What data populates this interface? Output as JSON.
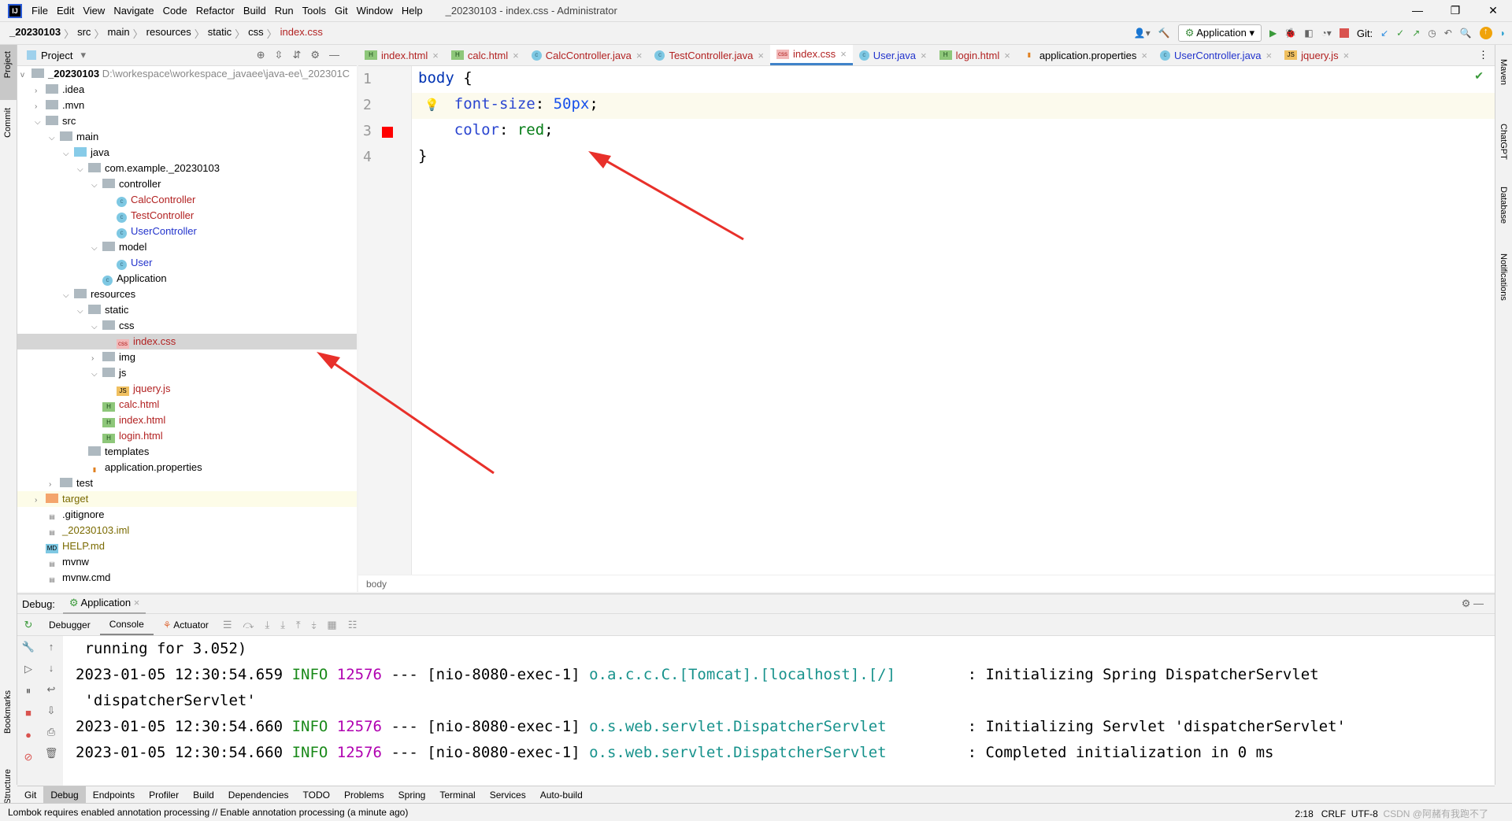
{
  "window": {
    "title": "_20230103 - index.css - Administrator",
    "logo": "IJ"
  },
  "menu": [
    "File",
    "Edit",
    "View",
    "Navigate",
    "Code",
    "Refactor",
    "Build",
    "Run",
    "Tools",
    "Git",
    "Window",
    "Help"
  ],
  "breadcrumb": [
    "_20230103",
    "src",
    "main",
    "resources",
    "static",
    "css",
    "index.css"
  ],
  "toolbar": {
    "run_config": "Application",
    "git_label": "Git:"
  },
  "project": {
    "header": "Project",
    "root_name": "_20230103",
    "root_path": "D:\\workespace\\workespace_javaee\\java-ee\\_202301C",
    "rows": [
      {
        "label": ".idea",
        "depth": 1,
        "chev": ">",
        "kind": "folder",
        "color": ""
      },
      {
        "label": ".mvn",
        "depth": 1,
        "chev": ">",
        "kind": "folder",
        "color": ""
      },
      {
        "label": "src",
        "depth": 1,
        "chev": "v",
        "kind": "folder",
        "color": ""
      },
      {
        "label": "main",
        "depth": 2,
        "chev": "v",
        "kind": "folder",
        "color": ""
      },
      {
        "label": "java",
        "depth": 3,
        "chev": "v",
        "kind": "jfolder",
        "color": ""
      },
      {
        "label": "com.example._20230103",
        "depth": 4,
        "chev": "v",
        "kind": "folder",
        "color": ""
      },
      {
        "label": "controller",
        "depth": 5,
        "chev": "v",
        "kind": "folder",
        "color": ""
      },
      {
        "label": "CalcController",
        "depth": 6,
        "chev": "",
        "kind": "class",
        "color": "red"
      },
      {
        "label": "TestController",
        "depth": 6,
        "chev": "",
        "kind": "class",
        "color": "red"
      },
      {
        "label": "UserController",
        "depth": 6,
        "chev": "",
        "kind": "class",
        "color": "blue"
      },
      {
        "label": "model",
        "depth": 5,
        "chev": "v",
        "kind": "folder",
        "color": ""
      },
      {
        "label": "User",
        "depth": 6,
        "chev": "",
        "kind": "class",
        "color": "blue"
      },
      {
        "label": "Application",
        "depth": 5,
        "chev": "",
        "kind": "app",
        "color": ""
      },
      {
        "label": "resources",
        "depth": 3,
        "chev": "v",
        "kind": "folder",
        "color": ""
      },
      {
        "label": "static",
        "depth": 4,
        "chev": "v",
        "kind": "folder",
        "color": ""
      },
      {
        "label": "css",
        "depth": 5,
        "chev": "v",
        "kind": "folder",
        "color": ""
      },
      {
        "label": "index.css",
        "depth": 6,
        "chev": "",
        "kind": "css",
        "color": "red",
        "selected": true
      },
      {
        "label": "img",
        "depth": 5,
        "chev": ">",
        "kind": "folder",
        "color": ""
      },
      {
        "label": "js",
        "depth": 5,
        "chev": "v",
        "kind": "folder",
        "color": ""
      },
      {
        "label": "jquery.js",
        "depth": 6,
        "chev": "",
        "kind": "js",
        "color": "red"
      },
      {
        "label": "calc.html",
        "depth": 5,
        "chev": "",
        "kind": "html",
        "color": "red"
      },
      {
        "label": "index.html",
        "depth": 5,
        "chev": "",
        "kind": "html",
        "color": "red"
      },
      {
        "label": "login.html",
        "depth": 5,
        "chev": "",
        "kind": "html",
        "color": "red"
      },
      {
        "label": "templates",
        "depth": 4,
        "chev": "",
        "kind": "folder",
        "color": ""
      },
      {
        "label": "application.properties",
        "depth": 4,
        "chev": "",
        "kind": "props",
        "color": ""
      },
      {
        "label": "test",
        "depth": 2,
        "chev": ">",
        "kind": "folder",
        "color": ""
      },
      {
        "label": "target",
        "depth": 1,
        "chev": ">",
        "kind": "ofolder",
        "color": "olive",
        "highlight": true
      },
      {
        "label": ".gitignore",
        "depth": 1,
        "chev": "",
        "kind": "file",
        "color": ""
      },
      {
        "label": "_20230103.iml",
        "depth": 1,
        "chev": "",
        "kind": "file",
        "color": "olive"
      },
      {
        "label": "HELP.md",
        "depth": 1,
        "chev": "",
        "kind": "md",
        "color": "olive"
      },
      {
        "label": "mvnw",
        "depth": 1,
        "chev": "",
        "kind": "file",
        "color": ""
      },
      {
        "label": "mvnw.cmd",
        "depth": 1,
        "chev": "",
        "kind": "file",
        "color": ""
      }
    ]
  },
  "tabs": [
    {
      "label": "index.html",
      "kind": "html",
      "color": "red"
    },
    {
      "label": "calc.html",
      "kind": "html",
      "color": "red"
    },
    {
      "label": "CalcController.java",
      "kind": "class",
      "color": "red"
    },
    {
      "label": "TestController.java",
      "kind": "class",
      "color": "red"
    },
    {
      "label": "index.css",
      "kind": "css",
      "color": "red",
      "active": true
    },
    {
      "label": "User.java",
      "kind": "class",
      "color": "blue"
    },
    {
      "label": "login.html",
      "kind": "html",
      "color": "red"
    },
    {
      "label": "application.properties",
      "kind": "props",
      "color": ""
    },
    {
      "label": "UserController.java",
      "kind": "class",
      "color": "blue"
    },
    {
      "label": "jquery.js",
      "kind": "js",
      "color": "red"
    }
  ],
  "editor": {
    "lines": [
      {
        "n": "1",
        "parts": [
          [
            "body",
            "#0033b3"
          ],
          [
            " {",
            "#000"
          ]
        ]
      },
      {
        "n": "2",
        "parts": [
          [
            "    font-size",
            "#2a45d0"
          ],
          [
            ": ",
            "#000"
          ],
          [
            "50px",
            "#1750eb"
          ],
          [
            ";",
            "#000"
          ]
        ]
      },
      {
        "n": "3",
        "parts": [
          [
            "    color",
            "#2a45d0"
          ],
          [
            ": ",
            "#000"
          ],
          [
            "red",
            "#067d17"
          ],
          [
            ";",
            "#000"
          ]
        ]
      },
      {
        "n": "4",
        "parts": [
          [
            "}",
            "#000"
          ]
        ]
      }
    ],
    "color_swatch": "#ff0000",
    "breadcrumb": "body"
  },
  "debug": {
    "label": "Debug:",
    "session": "Application",
    "tabs": [
      "Debugger",
      "Console",
      "Actuator"
    ]
  },
  "console": [
    {
      "plain": " running for 3.052)"
    },
    {
      "date": "2023-01-05 12:30:54.659",
      "level": "INFO",
      "pid": "12576",
      "thread": "--- [nio-8080-exec-1]",
      "logger": "o.a.c.c.C.[Tomcat].[localhost].[/]      ",
      "msg": " : Initializing Spring DispatcherServlet"
    },
    {
      "plain": " 'dispatcherServlet'"
    },
    {
      "date": "2023-01-05 12:30:54.660",
      "level": "INFO",
      "pid": "12576",
      "thread": "--- [nio-8080-exec-1]",
      "logger": "o.s.web.servlet.DispatcherServlet       ",
      "msg": " : Initializing Servlet 'dispatcherServlet'"
    },
    {
      "date": "2023-01-05 12:30:54.660",
      "level": "INFO",
      "pid": "12576",
      "thread": "--- [nio-8080-exec-1]",
      "logger": "o.s.web.servlet.DispatcherServlet       ",
      "msg": " : Completed initialization in 0 ms"
    }
  ],
  "left_stripe": [
    "Project",
    "Commit",
    "Bookmarks",
    "Structure"
  ],
  "right_stripe": [
    "Maven",
    "ChatGPT",
    "Database",
    "Notifications"
  ],
  "bottom_tools": [
    "Git",
    "Debug",
    "Endpoints",
    "Profiler",
    "Build",
    "Dependencies",
    "TODO",
    "Problems",
    "Spring",
    "Terminal",
    "Services",
    "Auto-build"
  ],
  "status": {
    "message": "Lombok requires enabled annotation processing // Enable annotation processing (a minute ago)",
    "position": "2:18",
    "line_sep": "CRLF",
    "encoding": "UTF-8",
    "watermark": "CSDN @阿赭有我跑不了"
  },
  "arrow_color": "#e8302a"
}
